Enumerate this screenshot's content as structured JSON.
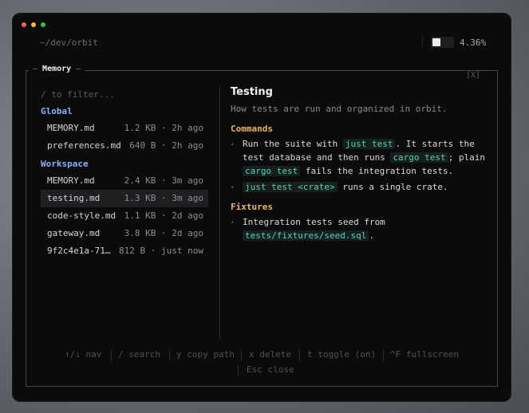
{
  "window": {
    "path": "~/dev/orbit",
    "usage": {
      "fraction": 0.4,
      "percent_label": "4.36%"
    }
  },
  "panel": {
    "title": "Memory",
    "close_label": "[X]",
    "filter_placeholder": "/ to filter..."
  },
  "groups": [
    {
      "label": "Global",
      "files": [
        {
          "name": "MEMORY.md",
          "meta": "1.2 KB · 2h ago"
        },
        {
          "name": "preferences.md",
          "meta": "640 B · 2h ago"
        }
      ]
    },
    {
      "label": "Workspace",
      "files": [
        {
          "name": "MEMORY.md",
          "meta": "2.4 KB · 3m ago"
        },
        {
          "name": "testing.md",
          "meta": "1.3 KB · 3m ago",
          "selected": true
        },
        {
          "name": "code-style.md",
          "meta": "1.1 KB · 2d ago"
        },
        {
          "name": "gateway.md",
          "meta": "3.8 KB · 2d ago"
        },
        {
          "name": "9f2c4e1a-71…",
          "meta": "812 B · just now"
        }
      ]
    }
  ],
  "doc": {
    "title": "Testing",
    "subtitle": "How tests are run and organized in orbit.",
    "sections": [
      {
        "heading": "Commands",
        "bullets": [
          [
            [
              {
                "t": "Run the suite with "
              },
              {
                "t": "just test",
                "code": true
              },
              {
                "t": ". It starts the"
              }
            ],
            [
              {
                "t": "test database and then runs "
              },
              {
                "t": "cargo test",
                "code": true
              },
              {
                "t": "; plain"
              }
            ],
            [
              {
                "t": "cargo test",
                "code": true
              },
              {
                "t": " fails the integration tests."
              }
            ]
          ],
          [
            [
              {
                "t": "just test <crate>",
                "code": true
              },
              {
                "t": " runs a single crate."
              }
            ]
          ]
        ]
      },
      {
        "heading": "Fixtures",
        "bullets": [
          [
            [
              {
                "t": "Integration tests seed from"
              }
            ],
            [
              {
                "t": "tests/fixtures/seed.sql",
                "code": true
              },
              {
                "t": "."
              }
            ]
          ]
        ]
      }
    ]
  },
  "hints": [
    "↑/↓ nav",
    "/ search",
    "y copy path",
    "x delete",
    "t toggle (on)",
    "^F fullscreen",
    "Esc close"
  ]
}
